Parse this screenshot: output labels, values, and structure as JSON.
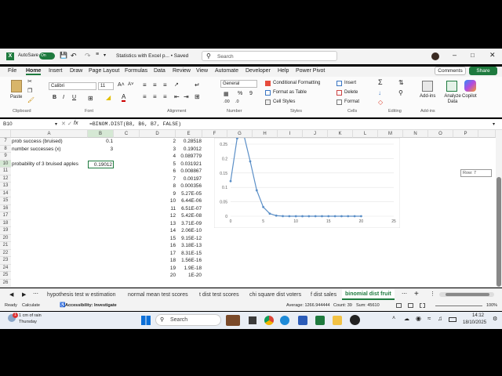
{
  "title_bar": {
    "autosave_label": "AutoSave",
    "autosave_state": "On",
    "file_title": "Statistics with Excel p... • Saved",
    "search_placeholder": "Search"
  },
  "menu": [
    "File",
    "Home",
    "Insert",
    "Draw",
    "Page Layout",
    "Formulas",
    "Data",
    "Review",
    "View",
    "Automate",
    "Developer",
    "Help",
    "Power Pivot"
  ],
  "menu_active": "Home",
  "buttons": {
    "comments": "Comments",
    "share": "Share"
  },
  "ribbon": {
    "paste": "Paste",
    "font_name": "Calibri",
    "font_size": "11",
    "number_format": "General",
    "conditional_formatting": "Conditional Formatting",
    "format_as_table": "Format as Table",
    "cell_styles": "Cell Styles",
    "insert": "Insert",
    "delete": "Delete",
    "format": "Format",
    "add_ins": "Add-ins",
    "analyze_data": "Analyze Data",
    "copilot": "Copilot",
    "groups": [
      "Clipboard",
      "Font",
      "Alignment",
      "Number",
      "Styles",
      "Cells",
      "Editing",
      "Add-ins"
    ]
  },
  "formula_bar": {
    "name_box": "B10",
    "fx": "fx",
    "formula": "=BINOM.DIST(B8, B6, B7, FALSE)"
  },
  "columns": [
    "A",
    "B",
    "C",
    "D",
    "E",
    "F",
    "G",
    "H",
    "I",
    "J",
    "K",
    "L",
    "M",
    "N",
    "O",
    "P"
  ],
  "rows": [
    "7",
    "8",
    "9",
    "10",
    "11",
    "12",
    "13",
    "14",
    "15",
    "16",
    "17",
    "18",
    "19",
    "20",
    "21",
    "22",
    "23",
    "24",
    "25",
    "26"
  ],
  "cells": {
    "a7": "prob success (bruised)",
    "b7": "0.1",
    "a8": "number successes (x)",
    "b8": "3",
    "a10": "probability  of 3 bruised apples",
    "b10": "0.19012"
  },
  "table_d": [
    "2",
    "3",
    "4",
    "5",
    "6",
    "7",
    "8",
    "9",
    "10",
    "11",
    "12",
    "13",
    "14",
    "15",
    "16",
    "17",
    "18",
    "19",
    "20"
  ],
  "table_e": [
    "0.28518",
    "0.19012",
    "0.089779",
    "0.031921",
    "0.008867",
    "0.00197",
    "0.000356",
    "5.27E-05",
    "6.44E-06",
    "6.51E-07",
    "5.42E-08",
    "3.71E-09",
    "2.06E-10",
    "9.15E-12",
    "3.18E-13",
    "8.31E-15",
    "1.56E-16",
    "1.9E-18",
    "1E-20"
  ],
  "row_tooltip": "Row: 7",
  "chart_data": {
    "type": "scatter",
    "x": [
      0,
      1,
      2,
      3,
      4,
      5,
      6,
      7,
      8,
      9,
      10,
      11,
      12,
      13,
      14,
      15,
      16,
      17,
      18,
      19,
      20
    ],
    "y": [
      0.121577,
      0.27017,
      0.28518,
      0.19012,
      0.089779,
      0.031921,
      0.008867,
      0.00197,
      0.000356,
      5.27e-05,
      6.44e-06,
      6.51e-07,
      5.42e-08,
      0.0,
      0.0,
      0.0,
      0.0,
      0.0,
      0.0,
      0.0,
      0.0
    ],
    "xticks": [
      "0",
      "5",
      "10",
      "15",
      "20",
      "25"
    ],
    "yticks": [
      "0",
      "0.05",
      "0.1",
      "0.15",
      "0.2",
      "0.25"
    ],
    "xlim": [
      0,
      25
    ],
    "ylim": [
      0,
      0.25
    ],
    "color": "#5b8fc7"
  },
  "sheet_tabs": [
    "hypothesis test w estimation",
    "normal mean test scores",
    "t dist test scores",
    "chi square dist voters",
    "f dist sales",
    "binomial dist fruit"
  ],
  "active_tab": "binomial dist fruit",
  "status": {
    "ready": "Ready",
    "calculate": "Calculate",
    "accessibility": "Accessibility: Investigate",
    "average": "Average: 1266.944444",
    "count": "Count: 39",
    "sum": "Sum: 45610",
    "zoom": "100%"
  },
  "taskbar": {
    "weather": "1 cm of rain",
    "weather_day": "Thursday",
    "search": "Search",
    "time": "14:12",
    "date": "18/10/2025",
    "badge": "1"
  }
}
